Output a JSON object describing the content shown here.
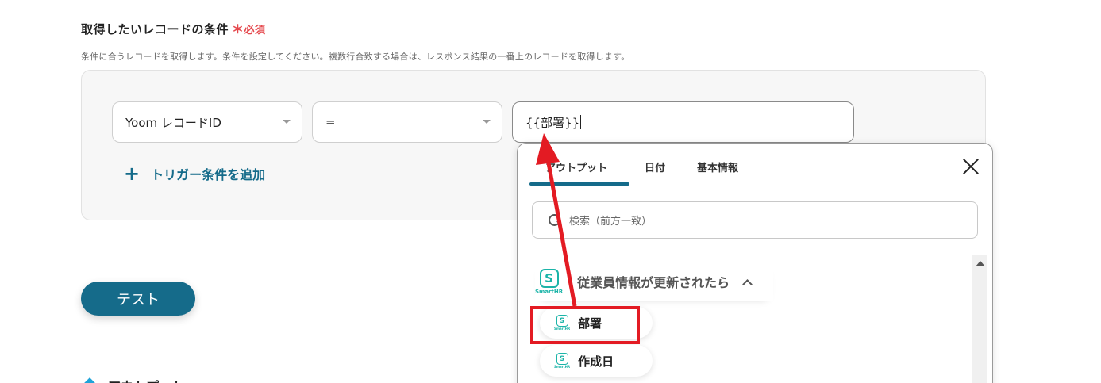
{
  "section": {
    "title": "取得したいレコードの条件",
    "required_mark": "＊",
    "required_label": "必須",
    "description": "条件に合うレコードを取得します。条件を設定してください。複数行合致する場合は、レスポンス結果の一番上のレコードを取得します。"
  },
  "condition": {
    "field_select": "Yoom レコードID",
    "operator_select": "=",
    "value_input": "{{部署}}"
  },
  "add_trigger_label": "トリガー条件を追加",
  "test_button_label": "テスト",
  "bottom_heading": "アウトプット",
  "popup": {
    "tabs": [
      {
        "label": "アウトプット"
      },
      {
        "label": "日付"
      },
      {
        "label": "基本情報"
      }
    ],
    "search_placeholder": "検索（前方一致）",
    "group": {
      "app_logo_letter": "S",
      "app_logo_text": "SmartHR",
      "title": "従業員情報が更新されたら"
    },
    "items": [
      {
        "label": "部署"
      },
      {
        "label": "作成日"
      }
    ]
  },
  "colors": {
    "accent": "#156b8a",
    "required": "#e5484d",
    "highlight": "#e31b23",
    "smarthr": "#1bb4a8"
  }
}
